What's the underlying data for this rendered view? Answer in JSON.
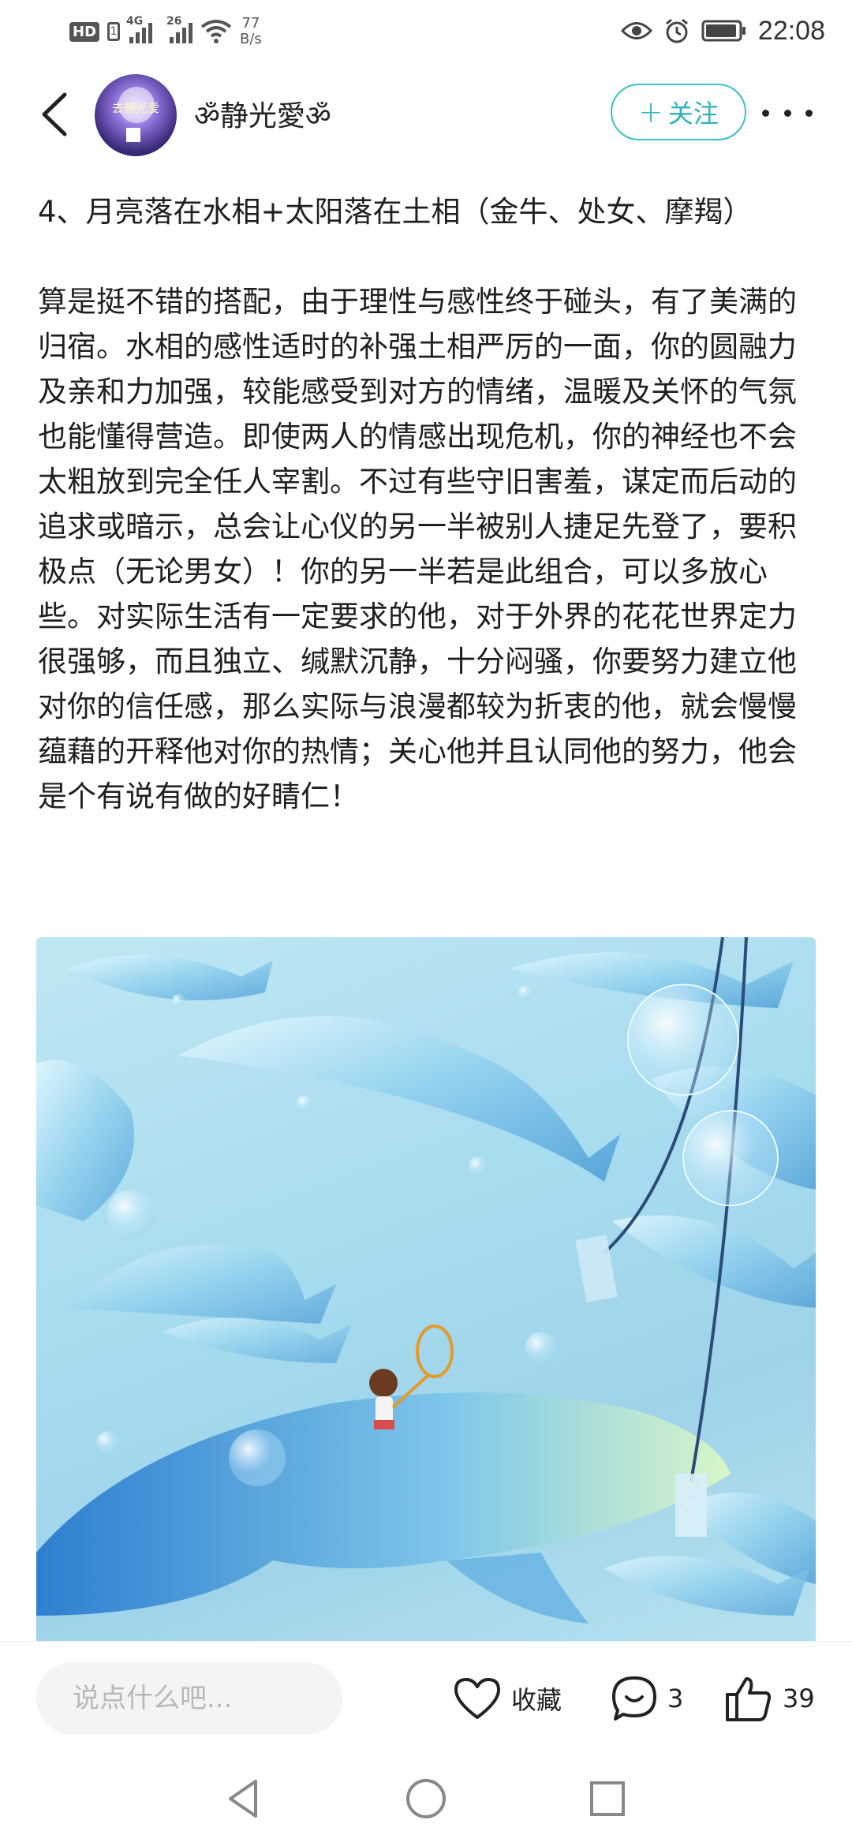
{
  "status_bar": {
    "hd_label": "HD",
    "sim_label": "1",
    "signal1_label": "4G",
    "signal2_label": "26",
    "net_speed_value": "77",
    "net_speed_unit": "B/s",
    "time": "22:08",
    "icons": [
      "eye-icon",
      "alarm-icon",
      "battery-icon",
      "wifi-icon"
    ]
  },
  "header": {
    "username": "ॐ静光愛ॐ",
    "avatar_text": "去静光爱",
    "follow_label": "关注"
  },
  "article": {
    "heading": "4、月亮落在水相+太阳落在土相（金牛、处女、摩羯）",
    "body": "算是挺不错的搭配，由于理性与感性终于碰头，有了美满的归宿。水相的感性适时的补强土相严厉的一面，你的圆融力及亲和力加强，较能感受到对方的情绪，温暖及关怀的气氛也能懂得营造。即使两人的情感出现危机，你的神经也不会太粗放到完全任人宰割。不过有些守旧害羞，谋定而后动的追求或暗示，总会让心仪的另一半被别人捷足先登了，要积极点（无论男女）！你的另一半若是此组合，可以多放心些。对实际生活有一定要求的他，对于外界的花花世界定力很强够，而且独立、缄默沉静，十分闷骚，你要努力建立他对你的信任感，那么实际与浪漫都较为折衷的他，就会慢慢蕴藉的开释他对你的热情；关心他并且认同他的努力，他会是个有说有做的好睛仁！"
  },
  "bottom_bar": {
    "comment_placeholder": "说点什么吧...",
    "favorite_label": "收藏",
    "comment_count": "3",
    "like_count": "39"
  },
  "colors": {
    "accent": "#2fb2b8",
    "illustration_bg": "#a8dcef"
  }
}
